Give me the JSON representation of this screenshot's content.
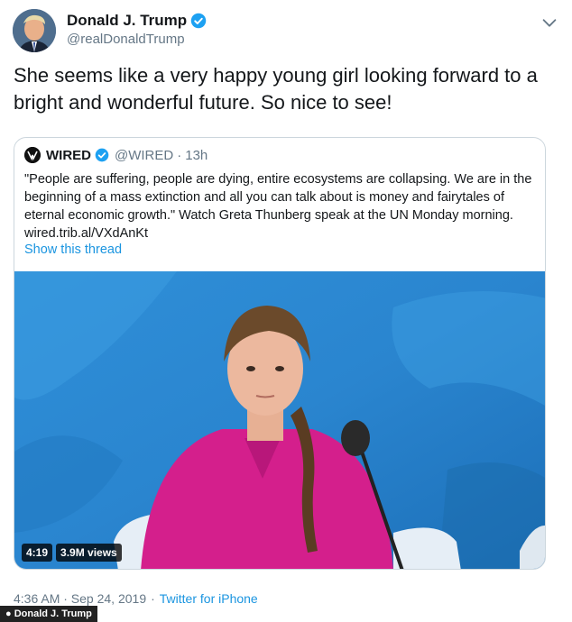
{
  "tweet": {
    "author_name": "Donald J. Trump",
    "author_handle": "@realDonaldTrump",
    "text": "She seems like a very happy young girl looking forward to a bright and wonderful future. So nice to see!",
    "timestamp": "4:36 AM · Sep 24, 2019",
    "dot": "·",
    "source": "Twitter for iPhone",
    "icons": {
      "verified": "verified-badge-icon",
      "menu": "chevron-down-icon"
    }
  },
  "quote": {
    "name": "WIRED",
    "handle": "@WIRED",
    "separator": "·",
    "age": "13h",
    "text": "\"People are suffering, people are dying, entire ecosystems are collapsing. We are in the beginning of a mass extinction and all you can talk about is money and fairytales of eternal economic growth.\" Watch Greta Thunberg speak at the UN Monday morning. wired.trib.al/VXdAnKt",
    "thread_link": "Show this thread",
    "video": {
      "duration": "4:19",
      "views": "3.9M views"
    }
  },
  "credit": "● Donald J. Trump",
  "colors": {
    "link": "#1b95e0",
    "secondary_text": "#657786",
    "verified": "#1da1f2",
    "border": "#ccd6dd"
  }
}
